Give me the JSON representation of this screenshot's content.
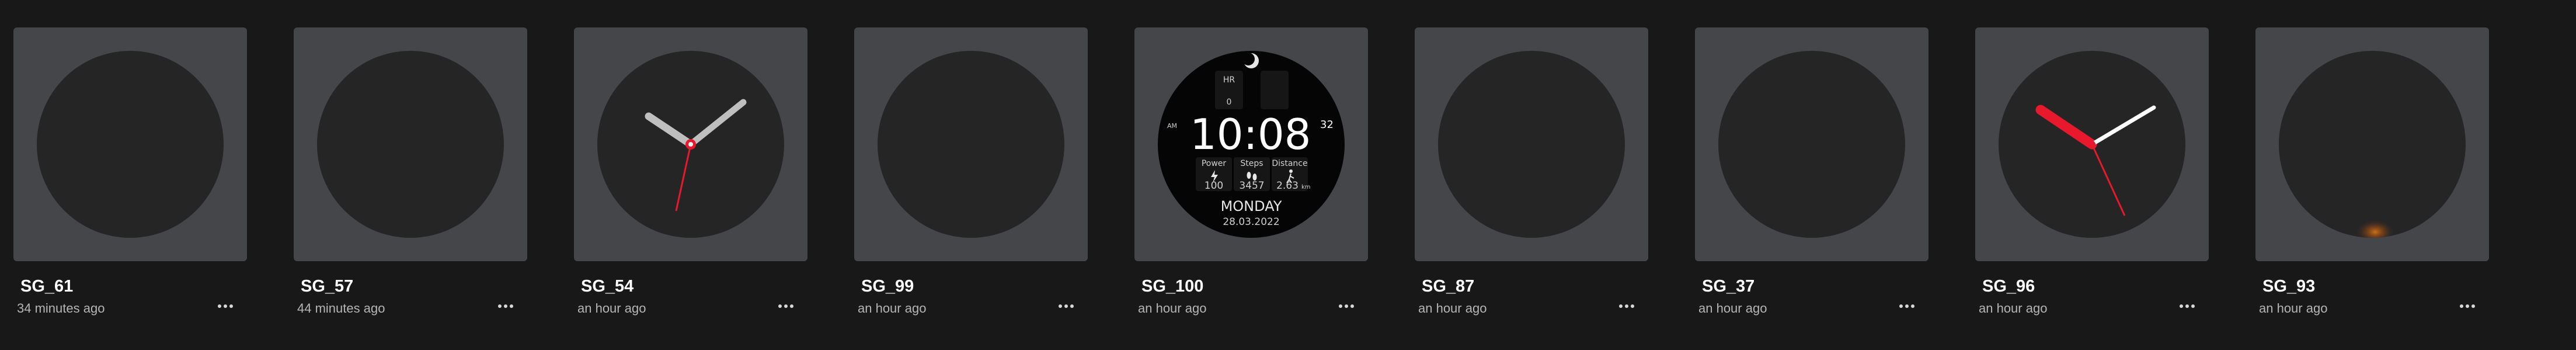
{
  "cards": [
    {
      "name": "SG_61",
      "modified": "34 minutes ago"
    },
    {
      "name": "SG_57",
      "modified": "44 minutes ago"
    },
    {
      "name": "SG_54",
      "modified": "an hour ago"
    },
    {
      "name": "SG_99",
      "modified": "an hour ago"
    },
    {
      "name": "SG_100",
      "modified": "an hour ago"
    },
    {
      "name": "SG_87",
      "modified": "an hour ago"
    },
    {
      "name": "SG_37",
      "modified": "an hour ago"
    },
    {
      "name": "SG_96",
      "modified": "an hour ago"
    },
    {
      "name": "SG_93",
      "modified": "an hour ago"
    }
  ],
  "digital_face": {
    "hr_label": "HR",
    "hr_value": "0",
    "ampm": "AM",
    "time": "10:08",
    "seconds": "32",
    "power_label": "Power",
    "power_value": "100",
    "steps_label": "Steps",
    "steps_value": "3457",
    "distance_label": "Distance",
    "distance_value": "2.63",
    "distance_unit": "km",
    "day": "MONDAY",
    "date": "28.03.2022"
  },
  "icons": {
    "more": "more-horizontal-icon",
    "moon": "moon-icon",
    "power": "bolt-icon",
    "steps": "footprints-icon",
    "distance": "walking-icon"
  },
  "colors": {
    "background": "#181818",
    "card": "#45464a",
    "face": "#252526",
    "accent_red": "#e8192c"
  }
}
